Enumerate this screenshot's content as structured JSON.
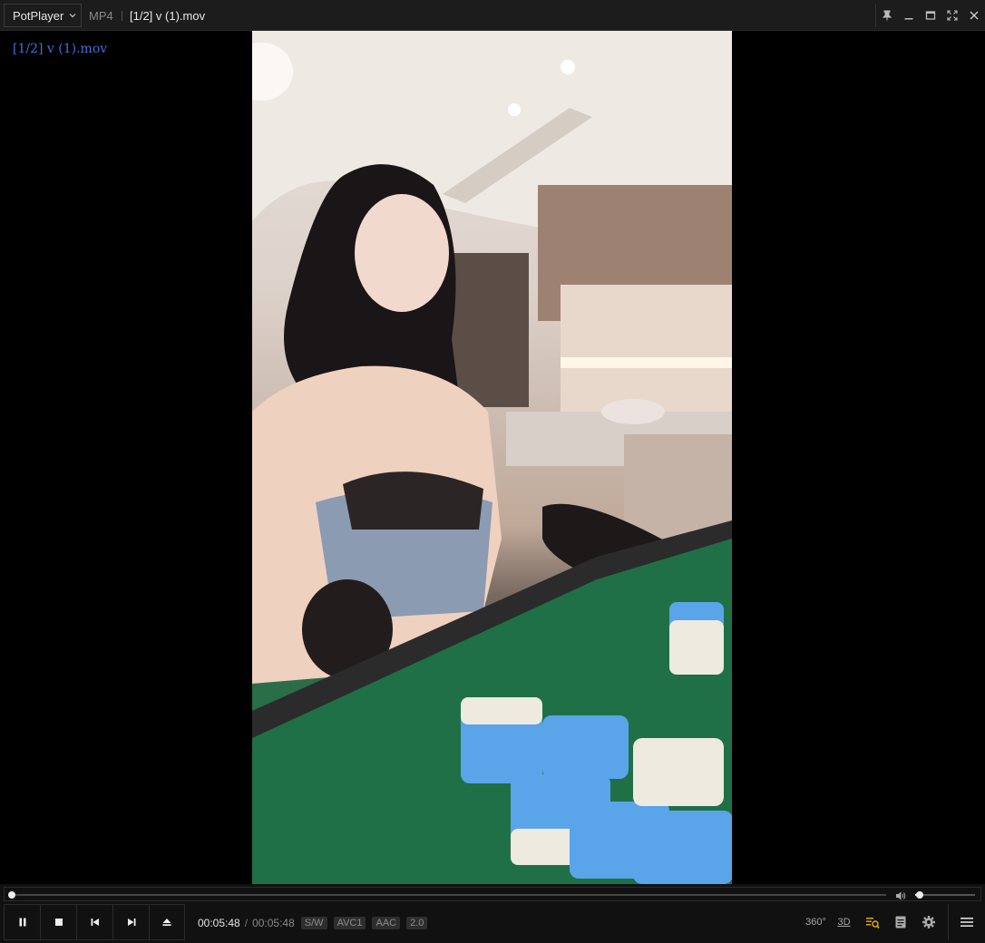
{
  "titlebar": {
    "app_name": "PotPlayer",
    "format": "MP4",
    "file_title": "[1/2] v (1).mov"
  },
  "osd": {
    "filename": "[1/2] v (1).mov"
  },
  "video": {
    "description_icon": "video-frame"
  },
  "playback": {
    "current_time": "00:05:48",
    "separator": "/",
    "total_time": "00:05:48",
    "badges": [
      "S/W",
      "AVC1",
      "AAC",
      "2.0"
    ],
    "progress": 0.0,
    "volume": 0.08
  },
  "right_controls": {
    "vr_label": "360°",
    "three_d_label": "3D"
  },
  "colors": {
    "osd_text": "#3f6fe0",
    "accent_icon": "#e8b100",
    "bar_bg": "#1c1c1c"
  }
}
